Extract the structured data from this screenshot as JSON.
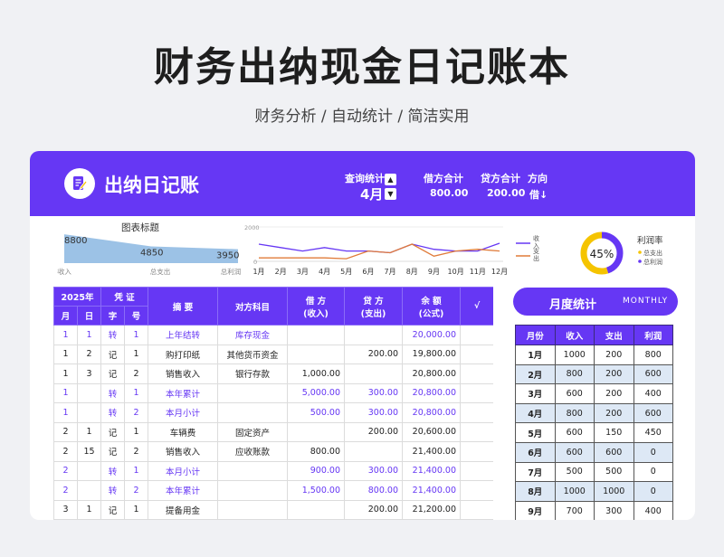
{
  "page": {
    "title": "财务出纳现金日记账本",
    "subtitle": "财务分析 / 自动统计 / 简洁实用"
  },
  "header": {
    "app_title": "出纳日记账",
    "query_label": "查询统计",
    "month_value": "4月",
    "debit_label": "借方合计",
    "debit_value": "800.00",
    "credit_label": "贷方合计",
    "credit_value": "200.00",
    "direction_label": "方向",
    "direction_value": "借↓"
  },
  "chart_data": [
    {
      "type": "area",
      "title": "图表标题",
      "x": [
        "3收入",
        "总支出",
        "总利润"
      ],
      "values": [
        8800,
        4850,
        3950
      ],
      "data_labels": [
        "8800",
        "4850",
        "3950"
      ]
    },
    {
      "type": "line",
      "x": [
        "1月",
        "2月",
        "3月",
        "4月",
        "5月",
        "6月",
        "7月",
        "8月",
        "9月",
        "10月",
        "11月",
        "12月"
      ],
      "yticks": [
        "2000",
        "0"
      ],
      "ylim": [
        0,
        2000
      ],
      "series": [
        {
          "name": "收入",
          "color": "#6637f4",
          "values": [
            1000,
            800,
            600,
            800,
            600,
            600,
            500,
            1000,
            700,
            600,
            600,
            1050
          ]
        },
        {
          "name": "支出",
          "color": "#e07b39",
          "values": [
            200,
            200,
            200,
            200,
            150,
            600,
            500,
            1000,
            300,
            600,
            700,
            600
          ]
        }
      ],
      "legend": "right"
    },
    {
      "type": "pie",
      "center_label": "45%",
      "title": "利润率",
      "values": [
        45,
        55
      ],
      "colors": [
        "#6637f4",
        "#f5c400"
      ],
      "legend": [
        "总支出",
        "总利润"
      ]
    }
  ],
  "ledger": {
    "headers": {
      "year": "2025年",
      "voucher": "凭 证",
      "month": "月",
      "day": "日",
      "zi": "字",
      "hao": "号",
      "summary": "摘 要",
      "account": "对方科目",
      "debit": "借 方",
      "debit_sub": "(收入)",
      "credit": "贷 方",
      "credit_sub": "(支出)",
      "balance": "余 额",
      "balance_sub": "(公式)",
      "check": "√"
    },
    "rows": [
      {
        "m": "1",
        "d": "1",
        "zi": "转",
        "hao": "1",
        "summary": "上年结转",
        "account": "库存现金",
        "debit": "",
        "credit": "",
        "balance": "20,000.00",
        "purple": true
      },
      {
        "m": "1",
        "d": "2",
        "zi": "记",
        "hao": "1",
        "summary": "购打印纸",
        "account": "其他货币资金",
        "debit": "",
        "credit": "200.00",
        "balance": "19,800.00",
        "purple": false
      },
      {
        "m": "1",
        "d": "3",
        "zi": "记",
        "hao": "2",
        "summary": "销售收入",
        "account": "银行存款",
        "debit": "1,000.00",
        "credit": "",
        "balance": "20,800.00",
        "purple": false
      },
      {
        "m": "1",
        "d": "",
        "zi": "转",
        "hao": "1",
        "summary": "本年累计",
        "account": "",
        "debit": "5,000.00",
        "credit": "300.00",
        "balance": "20,800.00",
        "purple": true
      },
      {
        "m": "1",
        "d": "",
        "zi": "转",
        "hao": "2",
        "summary": "本月小计",
        "account": "",
        "debit": "500.00",
        "credit": "300.00",
        "balance": "20,800.00",
        "purple": true
      },
      {
        "m": "2",
        "d": "1",
        "zi": "记",
        "hao": "1",
        "summary": "车辆费",
        "account": "固定资产",
        "debit": "",
        "credit": "200.00",
        "balance": "20,600.00",
        "purple": false
      },
      {
        "m": "2",
        "d": "15",
        "zi": "记",
        "hao": "2",
        "summary": "销售收入",
        "account": "应收账款",
        "debit": "800.00",
        "credit": "",
        "balance": "21,400.00",
        "purple": false
      },
      {
        "m": "2",
        "d": "",
        "zi": "转",
        "hao": "1",
        "summary": "本月小计",
        "account": "",
        "debit": "900.00",
        "credit": "300.00",
        "balance": "21,400.00",
        "purple": true
      },
      {
        "m": "2",
        "d": "",
        "zi": "转",
        "hao": "2",
        "summary": "本年累计",
        "account": "",
        "debit": "1,500.00",
        "credit": "800.00",
        "balance": "21,400.00",
        "purple": true
      },
      {
        "m": "3",
        "d": "1",
        "zi": "记",
        "hao": "1",
        "summary": "提备用金",
        "account": "",
        "debit": "",
        "credit": "200.00",
        "balance": "21,200.00",
        "purple": false
      }
    ]
  },
  "monthly": {
    "button_label": "月度统计",
    "button_en": "MONTHLY",
    "headers": [
      "月份",
      "收入",
      "支出",
      "利润"
    ],
    "rows": [
      [
        "1月",
        "1000",
        "200",
        "800"
      ],
      [
        "2月",
        "800",
        "200",
        "600"
      ],
      [
        "3月",
        "600",
        "200",
        "400"
      ],
      [
        "4月",
        "800",
        "200",
        "600"
      ],
      [
        "5月",
        "600",
        "150",
        "450"
      ],
      [
        "6月",
        "600",
        "600",
        "0"
      ],
      [
        "7月",
        "500",
        "500",
        "0"
      ],
      [
        "8月",
        "1000",
        "1000",
        "0"
      ],
      [
        "9月",
        "700",
        "300",
        "400"
      ]
    ]
  }
}
